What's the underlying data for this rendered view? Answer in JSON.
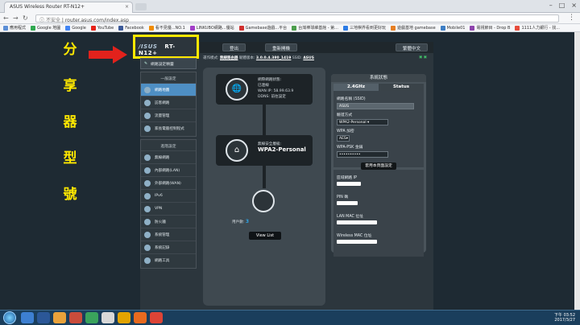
{
  "browser": {
    "tab_title": "ASUS Wireless Router RT-N12+",
    "tab_close": "×",
    "window_controls": [
      "–",
      "□",
      "×"
    ],
    "security_label": "不安全",
    "url": "router.asus.com/index.asp",
    "bookmarks": [
      {
        "label": "應用程式",
        "color": "#5c8fd6"
      },
      {
        "label": "Google 地圖",
        "color": "#2fa84f"
      },
      {
        "label": "Google",
        "color": "#4285f4"
      },
      {
        "label": "YouTube",
        "color": "#e62117"
      },
      {
        "label": "Facebook",
        "color": "#3b5998"
      },
      {
        "label": "看不見優...NO.1",
        "color": "#f08c00"
      },
      {
        "label": "LINKUBO網路...優站",
        "color": "#a23ec8"
      },
      {
        "label": "Gamebase遊戲...平台",
        "color": "#d0302f"
      },
      {
        "label": "台灣棒球維基館 - 第...",
        "color": "#4c9e4c"
      },
      {
        "label": "三地棋界看到更好玩",
        "color": "#2c7be5"
      },
      {
        "label": "遊戲基地 gamebase",
        "color": "#e67e22"
      },
      {
        "label": "Mobile01",
        "color": "#3c7dc4"
      },
      {
        "label": "電視節目 - Drop B",
        "color": "#8e44ad"
      },
      {
        "label": "1111人力銀行 - 找...",
        "color": "#e74c3c"
      }
    ]
  },
  "annotation": {
    "chars": [
      "分",
      "享",
      "器",
      "型",
      "號"
    ],
    "highlight_color": "#ffe800",
    "arrow_color": "#e2221c"
  },
  "router": {
    "brand": "/ISUS",
    "model": "RT-N12+",
    "top_buttons": [
      "登出",
      "重新開機"
    ],
    "language": "繁體中文",
    "info_bar": {
      "mode_label": "運作模式:",
      "mode_value": "無線路由器",
      "firmware_label": "韌體版本:",
      "firmware_value": "3.0.0.4.380_1419",
      "ssid_label": "SSID:",
      "ssid_value": "ASUS"
    },
    "sidebar": {
      "quick_setup": "網路設定精靈",
      "general_header": "一般設定",
      "general_items": [
        {
          "label": "網路地圖",
          "icon": "network-map-icon",
          "active": true
        },
        {
          "label": "訪客網路",
          "icon": "guest-network-icon",
          "active": false
        },
        {
          "label": "流量管理",
          "icon": "traffic-manager-icon",
          "active": false
        },
        {
          "label": "家長電腦控制程式",
          "icon": "parental-control-icon",
          "active": false
        }
      ],
      "advanced_header": "進階設定",
      "advanced_items": [
        {
          "label": "無線網路",
          "icon": "wireless-icon"
        },
        {
          "label": "內部網路(LAN)",
          "icon": "lan-icon"
        },
        {
          "label": "外部網路(WAN)",
          "icon": "wan-icon"
        },
        {
          "label": "IPv6",
          "icon": "ipv6-icon"
        },
        {
          "label": "VPN",
          "icon": "vpn-icon"
        },
        {
          "label": "防火牆",
          "icon": "firewall-icon"
        },
        {
          "label": "系統管理",
          "icon": "administration-icon"
        },
        {
          "label": "系統記錄",
          "icon": "system-log-icon"
        },
        {
          "label": "網路工具",
          "icon": "network-tools-icon"
        }
      ]
    },
    "map": {
      "internet_status_label": "網際網路狀態:",
      "internet_status_value": "已連線",
      "wan_ip_label": "WAN IP:",
      "wan_ip_value": "58.99.63.9",
      "ddns_label": "DDNS:",
      "ddns_value": "前往設定",
      "security_level_label": "無線安全層級:",
      "security_level_value": "WPA2-Personal",
      "clients_label": "用戶數:",
      "clients_value": "3",
      "view_list": "View List"
    },
    "panel": {
      "title": "系統狀態",
      "tabs": [
        "2.4GHz",
        "Status"
      ],
      "ssid_label": "網路名稱 (SSID)",
      "ssid_value": "ASUS",
      "auth_label": "驗證方式",
      "auth_value": "WPA2-Personal",
      "wpa_enc_label": "WPA 加密",
      "wpa_enc_value": "AES",
      "psk_label": "WPA-PSK 金鑰",
      "psk_value": "••••••••••",
      "apply_button": "套用本頁面設定",
      "lan_ip_label": "區域網路 IP",
      "pin_label": "PIN 碼",
      "lan_mac_label": "LAN MAC 位址",
      "wireless_mac_label": "Wireless MAC 位址"
    }
  },
  "taskbar": {
    "time": "下午 03:52",
    "date": "2017/3/27"
  }
}
